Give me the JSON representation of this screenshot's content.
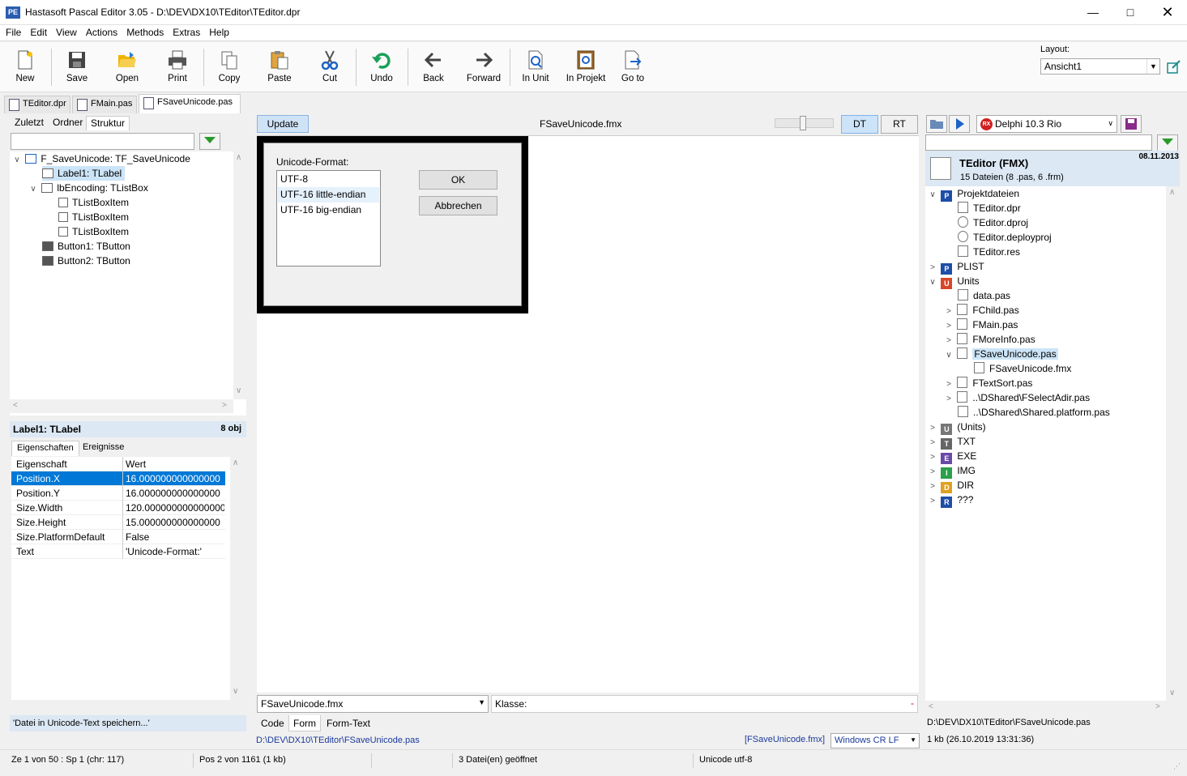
{
  "window": {
    "title": "Hastasoft Pascal Editor 3.05 - D:\\DEV\\DX10\\TEditor\\TEditor.dpr",
    "icon_text": "PE"
  },
  "menu": [
    "File",
    "Edit",
    "View",
    "Actions",
    "Methods",
    "Extras",
    "Help"
  ],
  "toolbar": {
    "buttons": [
      "New",
      "Save",
      "Open",
      "Print",
      "Copy",
      "Paste",
      "Cut",
      "Undo",
      "Back",
      "Forward",
      "In Unit",
      "In Projekt",
      "Go to"
    ],
    "layout_label": "Layout:",
    "layout_value": "Ansicht1"
  },
  "doc_tabs": [
    "TEditor.dpr",
    "FMain.pas",
    "FSaveUnicode.pas"
  ],
  "left": {
    "tabs": [
      "Zuletzt",
      "Ordner",
      "Struktur"
    ],
    "tree": [
      {
        "label": "F_SaveUnicode: TF_SaveUnicode",
        "icon": "form-icon"
      },
      {
        "label": "Label1: TLabel",
        "icon": "label-icon"
      },
      {
        "label": "lbEncoding: TListBox",
        "icon": "listbox-icon"
      },
      {
        "label": "TListBoxItem",
        "icon": "listbox-item-icon"
      },
      {
        "label": "TListBoxItem",
        "icon": "listbox-item-icon"
      },
      {
        "label": "TListBoxItem",
        "icon": "listbox-item-icon"
      },
      {
        "label": "Button1: TButton",
        "icon": "button-icon"
      },
      {
        "label": "Button2: TButton",
        "icon": "button-icon"
      }
    ],
    "object_title": "Label1: TLabel",
    "object_count": "8 obj",
    "prop_tabs": [
      "Eigenschaften",
      "Ereignisse"
    ],
    "prop_headers": [
      "Eigenschaft",
      "Wert"
    ],
    "props": [
      {
        "name": "Position.X",
        "value": "16.000000000000000"
      },
      {
        "name": "Position.Y",
        "value": "16.000000000000000"
      },
      {
        "name": "Size.Width",
        "value": "120.000000000000000"
      },
      {
        "name": "Size.Height",
        "value": "15.000000000000000"
      },
      {
        "name": "Size.PlatformDefault",
        "value": "False"
      },
      {
        "name": "Text",
        "value": "'Unicode-Format:'"
      }
    ],
    "description": "'Datei in Unicode-Text speichern...'"
  },
  "center": {
    "update_label": "Update",
    "title": "FSaveUnicode.fmx",
    "dt_label": "DT",
    "rt_label": "RT",
    "form": {
      "label": "Unicode-Format:",
      "list": [
        "UTF-8",
        "UTF-16 little-endian",
        "UTF-16 big-endian"
      ],
      "ok_label": "OK",
      "cancel_label": "Abbrechen"
    },
    "file_combo": "FSaveUnicode.fmx",
    "klasse_label": "Klasse:",
    "klasse_value": "-",
    "tabs": [
      "Code",
      "Form",
      "Form-Text"
    ],
    "path": "D:\\DEV\\DX10\\TEditor\\FSaveUnicode.pas",
    "fmx_link": "[FSaveUnicode.fmx]",
    "eol": "Windows CR LF"
  },
  "right": {
    "compiler": "Delphi 10.3 Rio",
    "project_title": "TEditor (FMX)",
    "project_sub": "15 Dateien (8 .pas, 6 .frm)",
    "project_date": "08.11.2013",
    "tree": [
      {
        "label": "Projektdateien",
        "cat": "P"
      },
      {
        "label": "TEditor.dpr"
      },
      {
        "label": "TEditor.dproj"
      },
      {
        "label": "TEditor.deployproj"
      },
      {
        "label": "TEditor.res"
      },
      {
        "label": "PLIST",
        "cat": "P"
      },
      {
        "label": "Units",
        "cat": "U"
      },
      {
        "label": "data.pas"
      },
      {
        "label": "FChild.pas"
      },
      {
        "label": "FMain.pas"
      },
      {
        "label": "FMoreInfo.pas"
      },
      {
        "label": "FSaveUnicode.pas"
      },
      {
        "label": "FSaveUnicode.fmx"
      },
      {
        "label": "FTextSort.pas"
      },
      {
        "label": "..\\DShared\\FSelectAdir.pas"
      },
      {
        "label": "..\\DShared\\Shared.platform.pas"
      },
      {
        "label": "(Units)",
        "cat": "U"
      },
      {
        "label": "TXT",
        "cat": "T"
      },
      {
        "label": "EXE",
        "cat": "E"
      },
      {
        "label": "IMG",
        "cat": "I"
      },
      {
        "label": "DIR",
        "cat": "D"
      },
      {
        "label": "???",
        "cat": "R"
      }
    ],
    "path": "D:\\DEV\\DX10\\TEditor\\FSaveUnicode.pas",
    "size": "1 kb (26.10.2019 13:31:36)"
  },
  "status": {
    "pos": "Ze 1 von 50 : Sp 1  (chr: 117)",
    "bytes": "Pos 2 von 1161 (1 kb)",
    "files": "3 Datei(en) geöffnet",
    "encoding": "Unicode utf-8"
  }
}
